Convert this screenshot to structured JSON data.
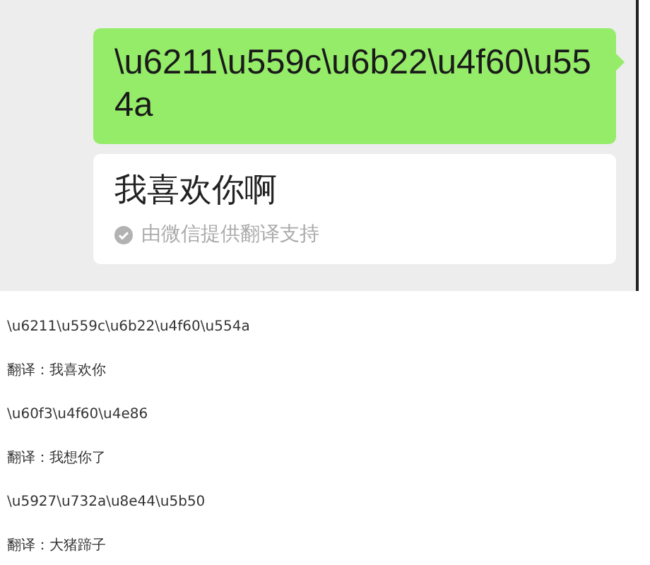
{
  "chat": {
    "message": "\\u6211\\u559c\\u6b22\\u4f60\\u554a",
    "translation": "我喜欢你啊",
    "translation_note": "由微信提供翻译支持"
  },
  "lines": [
    "\\u6211\\u559c\\u6b22\\u4f60\\u554a",
    "翻译：我喜欢你",
    "\\u60f3\\u4f60\\u4e86",
    "翻译：我想你了",
    "\\u5927\\u732a\\u8e44\\u5b50",
    "翻译：大猪蹄子"
  ]
}
